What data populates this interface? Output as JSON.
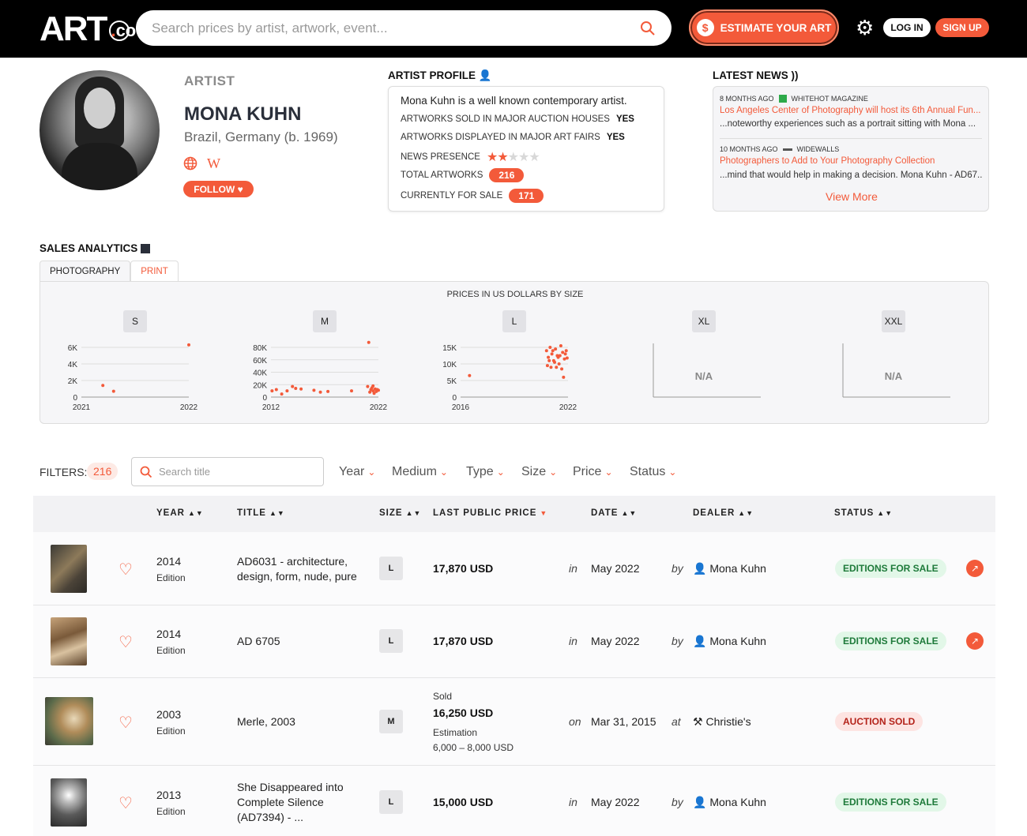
{
  "header": {
    "logo_text": "ART",
    "logo_dot": ".",
    "logo_suffix": "co",
    "search_placeholder": "Search prices by artist, artwork, event...",
    "estimate_label": "ESTIMATE YOUR ART",
    "login_label": "LOG IN",
    "signup_label": "SIGN UP"
  },
  "artist": {
    "label": "ARTIST",
    "name": "MONA KUHN",
    "origin": "Brazil, Germany (b. 1969)",
    "follow_label": "FOLLOW ♥"
  },
  "profile": {
    "title": "ARTIST PROFILE",
    "intro": "Mona Kuhn is a well known contemporary artist.",
    "rows": [
      {
        "label": "ARTWORKS SOLD IN MAJOR AUCTION HOUSES",
        "value": "YES"
      },
      {
        "label": "ARTWORKS DISPLAYED IN MAJOR ART FAIRS",
        "value": "YES"
      },
      {
        "label": "NEWS PRESENCE"
      },
      {
        "label": "TOTAL ARTWORKS",
        "value": "216"
      },
      {
        "label": "CURRENTLY FOR SALE",
        "value": "171"
      }
    ],
    "news_presence_stars": 2,
    "news_presence_max": 5
  },
  "news": {
    "title": "LATEST NEWS",
    "items": [
      {
        "age": "8 MONTHS AGO",
        "source": "WHITEHOT MAGAZINE",
        "headline": "Los Angeles Center of Photography will host its 6th Annual Fun...",
        "snippet": "...noteworthy experiences such as a portrait sitting with Mona ..."
      },
      {
        "age": "10 MONTHS AGO",
        "source": "WIDEWALLS",
        "headline": "Photographers to Add to Your Photography Collection",
        "snippet": "...mind that would help in making a decision. Mona Kuhn - AD67..."
      }
    ],
    "view_more": "View More"
  },
  "analytics": {
    "title": "SALES ANALYTICS",
    "tabs": [
      "PHOTOGRAPHY",
      "PRINT"
    ],
    "chart_title": "PRICES IN US DOLLARS BY SIZE",
    "na": "N/A"
  },
  "chart_data": [
    {
      "type": "scatter",
      "title": "S",
      "x": [
        2021.2,
        2021.3,
        2022.0
      ],
      "y": [
        1400,
        700,
        6300
      ],
      "xticks": [
        "2021",
        "2022"
      ],
      "yticks": [
        "0",
        "2K",
        "4K",
        "6K"
      ],
      "ylim": [
        0,
        6500
      ]
    },
    {
      "type": "scatter",
      "title": "M",
      "x": [
        2012.1,
        2012.5,
        2013.0,
        2013.5,
        2014.0,
        2014.3,
        2014.8,
        2016.0,
        2016.6,
        2017.3,
        2019.5,
        2021.0,
        2021.2,
        2021.3,
        2021.4,
        2021.5,
        2021.6,
        2021.7,
        2021.8,
        2021.9,
        2022.0,
        2021.1,
        2021.5
      ],
      "y": [
        10000,
        12000,
        5000,
        10000,
        17000,
        14000,
        13000,
        11000,
        8000,
        9000,
        10000,
        17000,
        8000,
        12000,
        15000,
        10000,
        6000,
        13000,
        9000,
        12000,
        11000,
        88000,
        17870
      ],
      "xticks": [
        "2012",
        "2022"
      ],
      "yticks": [
        "0",
        "20K",
        "40K",
        "60K",
        "80K"
      ],
      "ylim": [
        0,
        90000
      ]
    },
    {
      "type": "scatter",
      "title": "L",
      "x": [
        2016.5,
        2020.8,
        2020.9,
        2021.0,
        2021.1,
        2021.2,
        2021.3,
        2021.4,
        2021.5,
        2021.6,
        2021.7,
        2021.8,
        2021.9,
        2020.85,
        2021.05,
        2021.25,
        2021.45,
        2021.65,
        2021.85,
        2020.95,
        2021.15,
        2021.35,
        2021.55,
        2021.75,
        2021.95
      ],
      "y": [
        6500,
        14000,
        12000,
        15000,
        13000,
        11000,
        14500,
        12500,
        10000,
        15500,
        13500,
        11500,
        14000,
        9500,
        9000,
        10500,
        12000,
        8500,
        13000,
        11000,
        14000,
        9000,
        12500,
        6000,
        11800
      ],
      "xticks": [
        "2016",
        "2022"
      ],
      "yticks": [
        "0",
        "5K",
        "10K",
        "15K"
      ],
      "ylim": [
        0,
        16500
      ]
    },
    {
      "type": "scatter",
      "title": "XL",
      "x": [],
      "y": []
    },
    {
      "type": "scatter",
      "title": "XXL",
      "x": [],
      "y": []
    }
  ],
  "filters": {
    "label": "FILTERS:",
    "count": "216",
    "search_placeholder": "Search title",
    "dropdowns": [
      "Year",
      "Medium",
      "Type",
      "Size",
      "Price",
      "Status"
    ]
  },
  "table": {
    "headers": [
      "YEAR",
      "TITLE",
      "SIZE",
      "LAST PUBLIC PRICE",
      "DATE",
      "DEALER",
      "STATUS"
    ],
    "rows": [
      {
        "year": "2014",
        "kind": "Edition",
        "title1": "AD6031 - architecture,",
        "title2": "design, form, nude, pure",
        "size": "L",
        "price": "17,870 USD",
        "prep": "in",
        "date": "May 2022",
        "by": "by",
        "dealer": "Mona Kuhn",
        "status": "EDITIONS FOR SALE"
      },
      {
        "year": "2014",
        "kind": "Edition",
        "title1": "AD 6705",
        "size": "L",
        "price": "17,870 USD",
        "prep": "in",
        "date": "May 2022",
        "by": "by",
        "dealer": "Mona Kuhn",
        "status": "EDITIONS FOR SALE"
      },
      {
        "year": "2003",
        "kind": "Edition",
        "title1": "Merle, 2003",
        "size": "M",
        "sold_label": "Sold",
        "price": "16,250 USD",
        "est_label": "Estimation",
        "est_value": "6,000 – 8,000 USD",
        "prep": "on",
        "date": "Mar 31, 2015",
        "by": "at",
        "dealer": "Christie's",
        "status": "AUCTION SOLD"
      },
      {
        "year": "2013",
        "kind": "Edition",
        "title1": "She Disappeared into",
        "title2": "Complete Silence",
        "title3": "(AD7394) - ...",
        "size": "L",
        "price": "15,000 USD",
        "prep": "in",
        "date": "May 2022",
        "by": "by",
        "dealer": "Mona Kuhn",
        "status": "EDITIONS FOR SALE"
      }
    ]
  },
  "colors": {
    "accent": "#f35a3a",
    "green": "#1e7a3a",
    "red": "#b4231a"
  }
}
